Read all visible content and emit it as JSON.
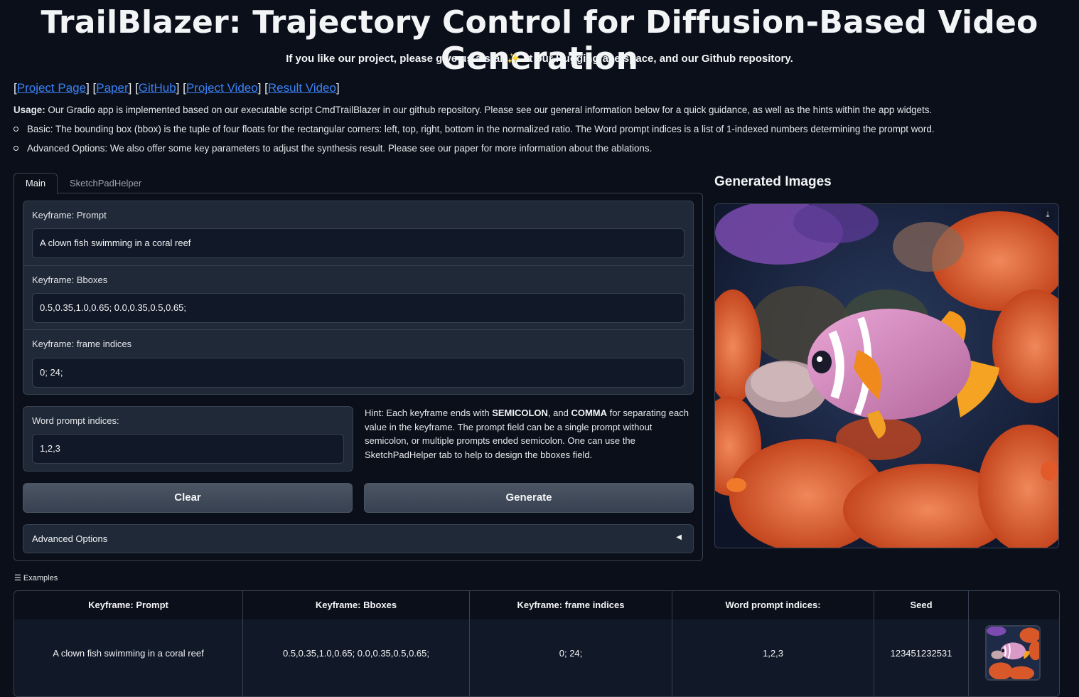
{
  "header": {
    "title": "TrailBlazer: Trajectory Control for Diffusion-Based Video Generation",
    "subtitle": "If you like our project, please give us a star ✨ at our Huggingface space, and our Github repository."
  },
  "links": [
    "Project Page",
    "Paper",
    "GitHub",
    "Project Video",
    "Result Video"
  ],
  "usage": {
    "label": "Usage:",
    "text": " Our Gradio app is implemented based on our executable script CmdTrailBlazer in our github repository. Please see our general information below for a quick guidance, as well as the hints within the app widgets.",
    "bullets": [
      "Basic: The bounding box (bbox) is the tuple of four floats for the rectangular corners: left, top, right, bottom in the normalized ratio. The Word prompt indices is a list of 1-indexed numbers determining the prompt word.",
      "Advanced Options: We also offer some key parameters to adjust the synthesis result. Please see our paper for more information about the ablations."
    ]
  },
  "tabs": {
    "main": "Main",
    "sketch": "SketchPadHelper"
  },
  "form": {
    "prompt_label": "Keyframe: Prompt",
    "prompt_value": "A clown fish swimming in a coral reef",
    "bboxes_label": "Keyframe: Bboxes",
    "bboxes_value": "0.5,0.35,1.0,0.65; 0.0,0.35,0.5,0.65;",
    "frames_label": "Keyframe: frame indices",
    "frames_value": "0; 24;",
    "word_label": "Word prompt indices:",
    "word_value": "1,2,3"
  },
  "hint": {
    "p1": "Hint: Each keyframe ends with ",
    "b1": "SEMICOLON",
    "p2": ", and ",
    "b2": "COMMA",
    "p3": " for separating each value in the keyframe. The prompt field can be a single prompt without semicolon, or multiple prompts ended semicolon. One can use the SketchPadHelper tab to help to design the bboxes field."
  },
  "buttons": {
    "clear": "Clear",
    "generate": "Generate"
  },
  "advanced": {
    "label": "Advanced Options",
    "arrow": "◀"
  },
  "output": {
    "title": "Generated Images",
    "download_icon": "⤓"
  },
  "examples": {
    "label": "Examples",
    "headers": [
      "Keyframe: Prompt",
      "Keyframe: Bboxes",
      "Keyframe: frame indices",
      "Word prompt indices:",
      "Seed",
      ""
    ],
    "rows": [
      [
        "A clown fish swimming in a coral reef",
        "0.5,0.35,1.0,0.65; 0.0,0.35,0.5,0.65;",
        "0; 24;",
        "1,2,3",
        "123451232531",
        ""
      ]
    ]
  },
  "colors": {
    "background": "#0b0f19",
    "panel": "#1f2937",
    "link": "#3b82f6",
    "coral": "#e8653a",
    "fish": "#d98fc8"
  }
}
